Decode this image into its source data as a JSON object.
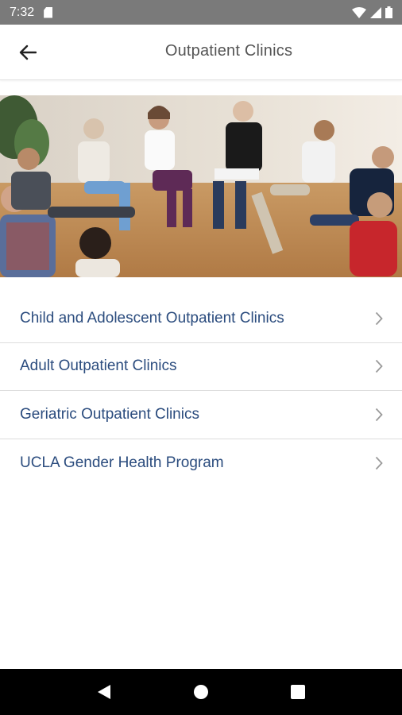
{
  "status_bar": {
    "time": "7:32",
    "icons": [
      "sd-card-icon",
      "wifi-icon",
      "signal-icon",
      "battery-icon"
    ]
  },
  "app_bar": {
    "title": "Outpatient Clinics",
    "back_icon": "arrow-left-icon"
  },
  "hero": {
    "description_icon": "group-therapy-photo"
  },
  "menu": {
    "items": [
      {
        "label": "Child and Adolescent Outpatient Clinics"
      },
      {
        "label": "Adult Outpatient Clinics"
      },
      {
        "label": "Geriatric Outpatient Clinics"
      },
      {
        "label": "UCLA Gender Health Program"
      }
    ]
  },
  "nav_bar": {
    "buttons": [
      "back-triangle-icon",
      "home-circle-icon",
      "recents-square-icon"
    ]
  },
  "colors": {
    "status_bar_bg": "#7a7a7a",
    "menu_text": "#2b4c7e",
    "title_text": "#555555",
    "nav_bar_bg": "#000000"
  }
}
